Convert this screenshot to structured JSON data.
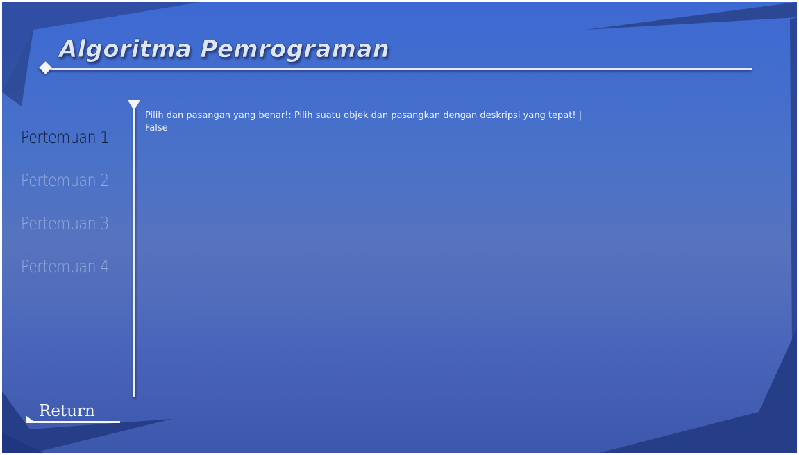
{
  "page": {
    "title": "Algoritma Pemrograman"
  },
  "sidebar": {
    "items": [
      {
        "label": "Pertemuan 1",
        "state": "selected"
      },
      {
        "label": "Pertemuan 2",
        "state": "unselected"
      },
      {
        "label": "Pertemuan 3",
        "state": "unselected"
      },
      {
        "label": "Pertemuan 4",
        "state": "unselected"
      }
    ]
  },
  "content": {
    "question_line": "Pilih dan pasangan yang benar!: Pilih suatu objek dan pasangkan dengan deskripsi yang tepat! |",
    "answer_value": "False"
  },
  "footer": {
    "return_label": "Return"
  },
  "colors": {
    "background_top": "#3d69d2",
    "background_bottom": "#3c57ac",
    "panel_dark": "#263e87",
    "selected_item_text": "#0f1a33",
    "unselected_item_text": "#95aad8",
    "line_white": "#eef0f5"
  },
  "icons": {
    "title_marker": "diamond-icon",
    "rail_marker": "triangle-down-icon",
    "return_marker": "wedge-icon"
  }
}
